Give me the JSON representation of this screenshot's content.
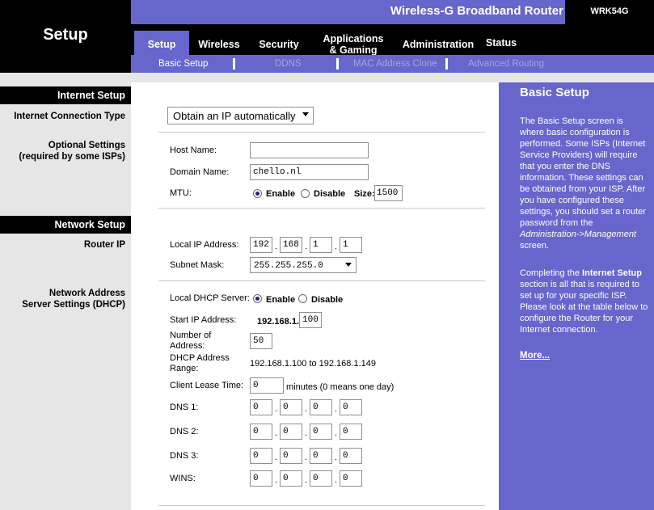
{
  "header": {
    "brand": "Setup",
    "product_name": "Wireless-G Broadband Router",
    "model": "WRK54G"
  },
  "tabs": [
    {
      "label": "Setup"
    },
    {
      "label": "Wireless"
    },
    {
      "label": "Security"
    },
    {
      "label": "Applications\n& Gaming"
    },
    {
      "label": "Administration"
    },
    {
      "label": "Status"
    }
  ],
  "subtabs": [
    {
      "label": "Basic Setup"
    },
    {
      "label": "DDNS"
    },
    {
      "label": "MAC Address Clone"
    },
    {
      "label": "Advanced Routing"
    }
  ],
  "sections": {
    "internet_setup": "Internet Setup",
    "internet_connection_type": "Internet Connection Type",
    "optional_settings": "Optional Settings\n(required by some ISPs)",
    "network_setup": "Network Setup",
    "router_ip": "Router IP",
    "dhcp": "Network Address\nServer Settings (DHCP)"
  },
  "connection_type": {
    "value": "Obtain an IP automatically"
  },
  "optional": {
    "host_name_label": "Host Name:",
    "host_name": "",
    "domain_name_label": "Domain Name:",
    "domain_name": "chello.nl",
    "mtu_label": "MTU:",
    "enable": "Enable",
    "disable": "Disable",
    "size_label": "Size:",
    "size": "1500"
  },
  "router_ip": {
    "local_ip_label": "Local IP Address:",
    "ip": [
      "192",
      "168",
      "1",
      "1"
    ],
    "subnet_label": "Subnet Mask:",
    "subnet": "255.255.255.0"
  },
  "dhcp": {
    "server_label": "Local DHCP Server:",
    "enable": "Enable",
    "disable": "Disable",
    "start_ip_label": "Start IP Address:",
    "start_ip_prefix": "192.168.1.",
    "start_ip_last": "100",
    "number_label": "Number  of\nAddress:",
    "number": "50",
    "range_label": "DHCP  Address\nRange:",
    "range": "192.168.1.100 to 192.168.1.149",
    "lease_label": "Client Lease Time:",
    "lease": "0",
    "lease_suffix": "minutes (0 means one day)",
    "dns1_label": "DNS 1:",
    "dns1": [
      "0",
      "0",
      "0",
      "0"
    ],
    "dns2_label": "DNS 2:",
    "dns2": [
      "0",
      "0",
      "0",
      "0"
    ],
    "dns3_label": "DNS 3:",
    "dns3": [
      "0",
      "0",
      "0",
      "0"
    ],
    "wins_label": "WINS:",
    "wins": [
      "0",
      "0",
      "0",
      "0"
    ]
  },
  "help": {
    "title": "Basic Setup",
    "p1_a": "The Basic Setup screen is where basic configuration is performed. Some ISPs (Internet Service Providers) will require that you enter the DNS information. These settings can be obtained from your ISP. After you have configured these settings, you should set a router password from the ",
    "p1_em": "Administration->Management",
    "p1_b": " screen.",
    "p2_a": "Completing the ",
    "p2_strong": "Internet Setup",
    "p2_b": " section is all that is required to set up for your specific ISP. Please look at the table below to configure the Router for your Internet connection.",
    "more": "More..."
  },
  "colors": {
    "accent": "#6666cc",
    "dark": "#000000",
    "panel": "#e6e6e6"
  }
}
